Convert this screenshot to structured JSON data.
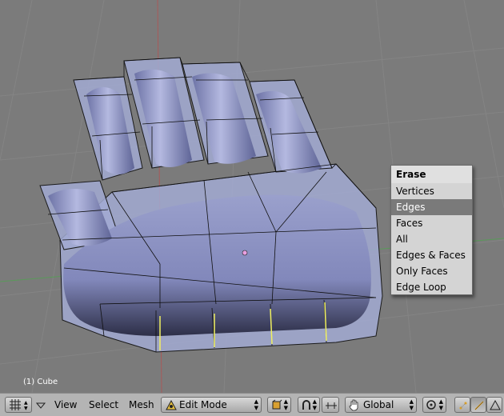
{
  "viewport": {
    "object_label": "(1) Cube"
  },
  "erase_menu": {
    "title": "Erase",
    "items": [
      {
        "label": "Vertices"
      },
      {
        "label": "Edges"
      },
      {
        "label": "Faces"
      },
      {
        "label": "All"
      },
      {
        "label": "Edges & Faces"
      },
      {
        "label": "Only Faces"
      },
      {
        "label": "Edge Loop"
      }
    ],
    "highlighted_item": "Edges"
  },
  "header": {
    "menus": {
      "view": "View",
      "select": "Select",
      "mesh": "Mesh"
    },
    "mode_selector": {
      "value": "Edit Mode",
      "icon": "edit-mode-icon"
    },
    "orientation_selector": {
      "value": "Global",
      "icon": "hand-icon"
    },
    "icons": [
      "viewport-type-icon",
      "collapse-triangle-icon",
      "draw-type-icon",
      "snap-magnet-icon",
      "manipulator-icon",
      "pivot-icon",
      "vertex-select-icon",
      "edge-select-icon",
      "face-select-icon"
    ]
  },
  "colors": {
    "viewport_bg": "#7b7b7b",
    "header_bg": "#b4b4b4",
    "mesh_fill": "#8c93c4",
    "cage_fill": "#a2aad2",
    "selected_edge": "#f0f060",
    "menu_highlight": "#7a7a7a"
  }
}
